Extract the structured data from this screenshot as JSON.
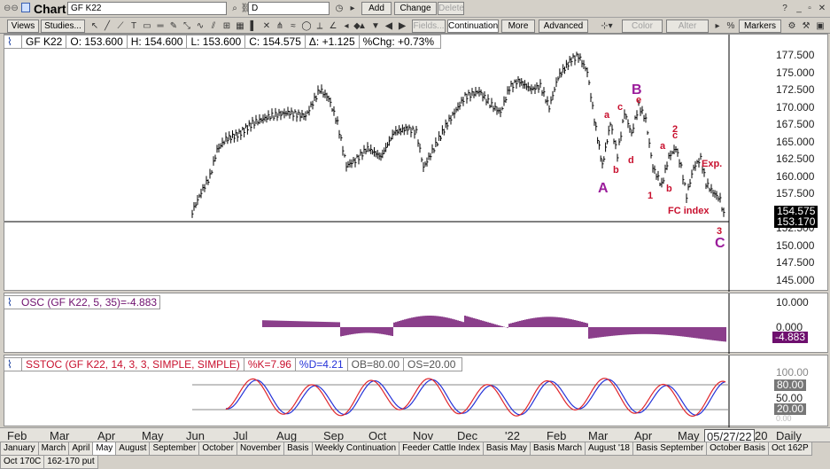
{
  "window": {
    "title": "Chart",
    "symbol": "GF K22",
    "timeframe": "D"
  },
  "toolbar_top": {
    "add": "Add",
    "change": "Change",
    "delete": "Delete"
  },
  "toolbar2": {
    "views": "Views",
    "studies": "Studies...",
    "fields": "Fields...",
    "continuation": "Continuation",
    "more": "More",
    "advanced": "Advanced",
    "color": "Color",
    "alter": "Alter",
    "percent": "%",
    "markers": "Markers"
  },
  "quote": {
    "symbol": "GF K22",
    "open": "O: 153.600",
    "high": "H: 154.600",
    "low": "L: 153.600",
    "close": "C: 154.575",
    "change": "Δ: +1.125",
    "pct": "%Chg: +0.73%"
  },
  "price_axis": {
    "ticks": [
      "177.500",
      "175.000",
      "172.500",
      "170.000",
      "167.500",
      "165.000",
      "162.500",
      "160.000",
      "157.500",
      "155.000",
      "152.500",
      "150.000",
      "147.500",
      "145.000"
    ],
    "last_price": "154.575",
    "cursor_price": "153.170"
  },
  "osc": {
    "legend": "OSC (GF K22, 5, 35)=-4.883",
    "ticks": [
      "10.000",
      "0.000"
    ],
    "value": "-4.883"
  },
  "sstoc": {
    "name": "SSTOC (GF K22, 14, 3, 3, SIMPLE, SIMPLE)",
    "k": "%K=7.96",
    "d": "%D=4.21",
    "ob": "OB=80.00",
    "os": "OS=20.00",
    "ticks": [
      "100.00",
      "80.00",
      "50.00",
      "20.00",
      "0.00"
    ]
  },
  "annotations": {
    "A": "A",
    "B": "B",
    "C": "C",
    "a1": "a",
    "b1": "b",
    "c1": "c",
    "d1": "d",
    "e1": "e",
    "n1": "1",
    "a2": "a",
    "b2": "b",
    "c2": "c",
    "n2": "2",
    "n3": "3",
    "exp": "Exp.",
    "fc": "FC index"
  },
  "x_axis": {
    "labels": [
      "Feb",
      "Mar",
      "Apr",
      "May",
      "Jun",
      "Jul",
      "Aug",
      "Sep",
      "Oct",
      "Nov",
      "Dec",
      "'22",
      "Feb",
      "Mar",
      "Apr",
      "May"
    ],
    "cursor_date": "05/27/22",
    "extra": "20",
    "period": "Daily"
  },
  "tabs": [
    "January",
    "March",
    "April",
    "May",
    "August",
    "September",
    "October",
    "November",
    "Basis",
    "Weekly Continuation",
    "Feeder Cattle Index",
    "Basis May",
    "Basis March",
    "August '18",
    "Basis September",
    "October Basis",
    "Oct 162P",
    "Oct 170C",
    "162-170 put"
  ],
  "active_tab": "May",
  "colors": {
    "wave_major": "#9b1d9b",
    "wave_minor": "#c8102e",
    "osc": "#6e0f6e",
    "stoc_k": "#e0262b",
    "stoc_d": "#2432d8"
  }
}
